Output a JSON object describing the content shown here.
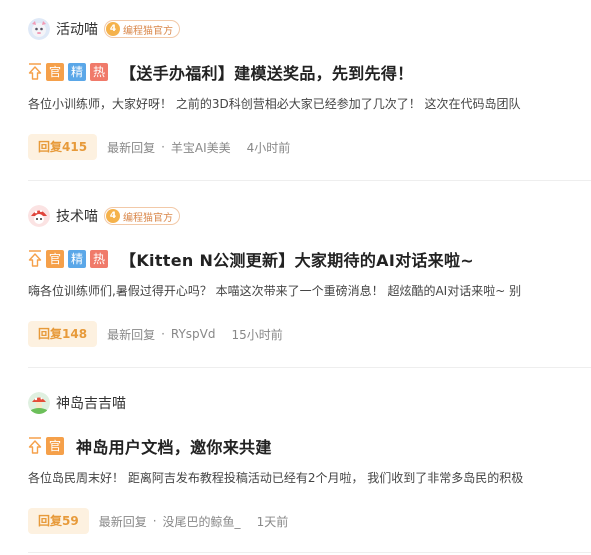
{
  "posts": [
    {
      "author": "活动喵",
      "badge_level": "4",
      "badge_text": "编程猫官方",
      "tags": [
        "官",
        "精",
        "热"
      ],
      "title": "【送手办福利】建模送奖品，先到先得！",
      "excerpt": "各位小训练师，大家好呀！ 之前的3D科创营相必大家已经参加了几次了！ 这次在代码岛团队",
      "reply_label": "回复415",
      "latest_label": "最新回复",
      "dot": "·",
      "latest_user": "羊宝AI美美",
      "time": "4小时前"
    },
    {
      "author": "技术喵",
      "badge_level": "4",
      "badge_text": "编程猫官方",
      "tags": [
        "官",
        "精",
        "热"
      ],
      "title": "【Kitten N公测更新】大家期待的AI对话来啦~",
      "excerpt": "嗨各位训练师们,暑假过得开心吗？ 本喵这次带来了一个重磅消息！ 超炫酷的AI对话来啦~ 别",
      "reply_label": "回复148",
      "latest_label": "最新回复",
      "dot": "·",
      "latest_user": "RYspVd",
      "time": "15小时前"
    },
    {
      "author": "神岛吉吉喵",
      "tags": [
        "官"
      ],
      "title": "神岛用户文档，邀你来共建",
      "excerpt": "各位岛民周末好！ 距离阿吉发布教程投稿活动已经有2个月啦， 我们收到了非常多岛民的积极",
      "reply_label": "回复59",
      "latest_label": "最新回复",
      "dot": "·",
      "latest_user": "没尾巴的鲸鱼_",
      "time": "1天前"
    }
  ]
}
